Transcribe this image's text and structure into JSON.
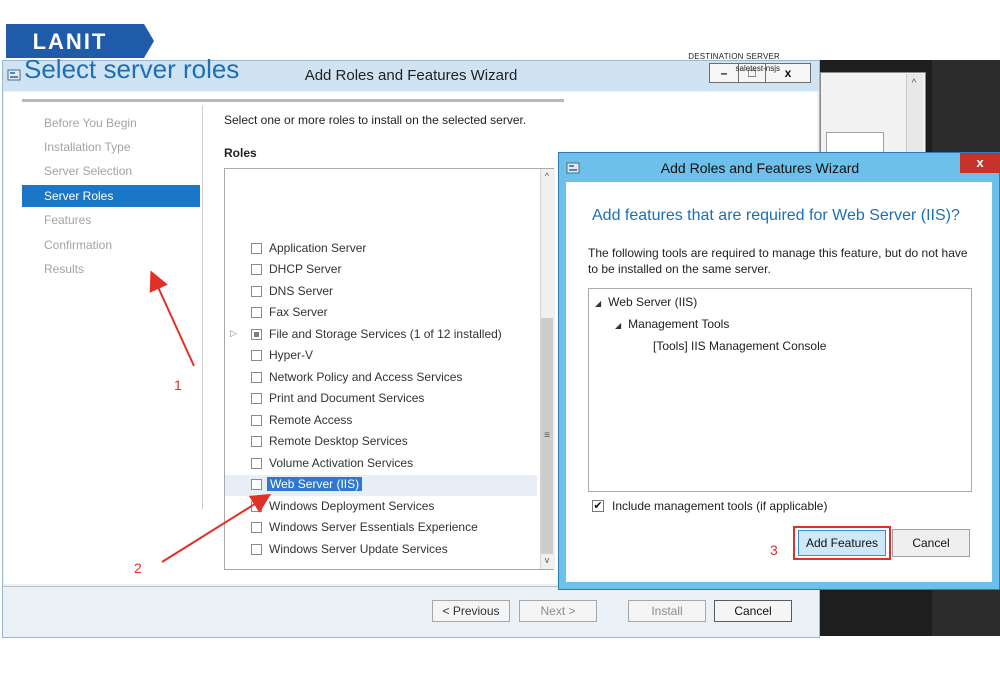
{
  "logo": {
    "text": "LANIT",
    "color": "#1f5ba8"
  },
  "background_window": {
    "scroll_up_glyph": "^"
  },
  "wizard": {
    "title": "Add Roles and Features Wizard",
    "controls": {
      "minimize": "–",
      "maximize": "□",
      "close": "x"
    },
    "page_title": "Select server roles",
    "destination": {
      "label": "DESTINATION SERVER",
      "server": "saletest-nsjs"
    },
    "nav": [
      {
        "label": "Before You Begin",
        "active": false
      },
      {
        "label": "Installation Type",
        "active": false
      },
      {
        "label": "Server Selection",
        "active": false
      },
      {
        "label": "Server Roles",
        "active": true
      },
      {
        "label": "Features",
        "active": false
      },
      {
        "label": "Confirmation",
        "active": false
      },
      {
        "label": "Results",
        "active": false
      }
    ],
    "description": "Select one or more roles to install on the selected server.",
    "roles_heading": "Roles",
    "roles": [
      {
        "label": "Application Server",
        "state": "unchecked"
      },
      {
        "label": "DHCP Server",
        "state": "unchecked"
      },
      {
        "label": "DNS Server",
        "state": "unchecked"
      },
      {
        "label": "Fax Server",
        "state": "unchecked"
      },
      {
        "label": "File and Storage Services (1 of 12 installed)",
        "state": "partial",
        "expandable": true
      },
      {
        "label": "Hyper-V",
        "state": "unchecked"
      },
      {
        "label": "Network Policy and Access Services",
        "state": "unchecked"
      },
      {
        "label": "Print and Document Services",
        "state": "unchecked"
      },
      {
        "label": "Remote Access",
        "state": "unchecked"
      },
      {
        "label": "Remote Desktop Services",
        "state": "unchecked"
      },
      {
        "label": "Volume Activation Services",
        "state": "unchecked"
      },
      {
        "label": "Web Server (IIS)",
        "state": "unchecked",
        "selected": true
      },
      {
        "label": "Windows Deployment Services",
        "state": "unchecked"
      },
      {
        "label": "Windows Server Essentials Experience",
        "state": "unchecked"
      },
      {
        "label": "Windows Server Update Services",
        "state": "unchecked"
      }
    ],
    "scroll": {
      "up": "^",
      "down": "v",
      "grip": "≡"
    },
    "buttons": {
      "previous": "< Previous",
      "next": "Next >",
      "install": "Install",
      "cancel": "Cancel"
    }
  },
  "dialog": {
    "title": "Add Roles and Features Wizard",
    "close": "x",
    "heading": "Add features that are required for Web Server (IIS)?",
    "description": "The following tools are required to manage this feature, but do not have to be installed on the same server.",
    "tree": [
      {
        "label": "Web Server (IIS)",
        "level": 0,
        "expanded": true
      },
      {
        "label": "Management Tools",
        "level": 1,
        "expanded": true
      },
      {
        "label": "[Tools] IIS Management Console",
        "level": 2,
        "expanded": false
      }
    ],
    "include_tools": {
      "label": "Include management tools (if applicable)",
      "checked": true,
      "check_glyph": "✔"
    },
    "buttons": {
      "add": "Add Features",
      "cancel": "Cancel"
    },
    "tree_arrow_glyph": "◢"
  },
  "annotations": {
    "color": "#e03029",
    "labels": [
      "1",
      "2",
      "3"
    ]
  }
}
